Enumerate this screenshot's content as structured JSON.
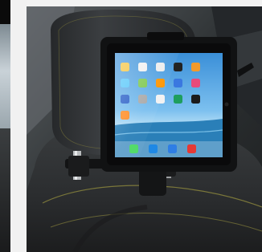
{
  "image": {
    "subject": "",
    "tablet_app_icons": [
      "photos-icon",
      "messages-icon",
      "calendar-icon",
      "clock-icon",
      "camera-icon",
      "maps-icon",
      "weather-icon",
      "notes-icon",
      "reminders-icon",
      "settings-icon",
      "music-icon",
      "videos-icon",
      "newsstand-icon",
      "store-icon",
      "books-icon",
      "game-icon"
    ],
    "dock_icons": [
      "phone-icon",
      "mail-icon",
      "safari-icon",
      "music-icon"
    ],
    "colors": {
      "background": "#f2f2f2",
      "upholstery": "#2e3133",
      "bracket": "#121314",
      "screen_sky": "#5fa9e6",
      "screen_sea": "#2a7fb8",
      "stitching": "#8f8a3d"
    }
  }
}
